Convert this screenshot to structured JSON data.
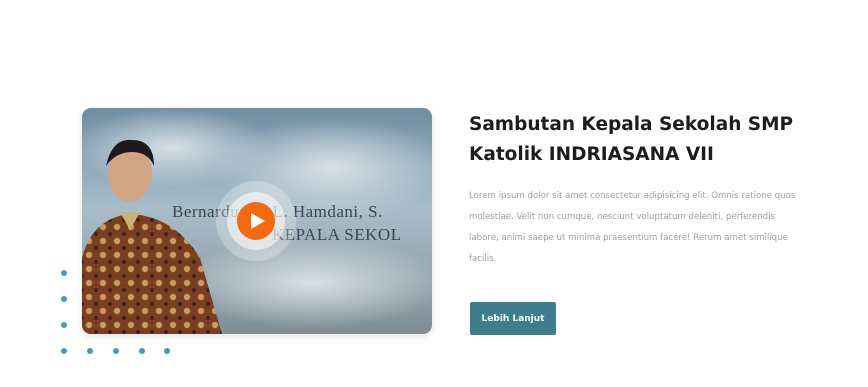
{
  "video": {
    "caption_name": "Bernardus B. L. Hamdani, S.",
    "caption_role": "KEPALA SEKOL"
  },
  "intro": {
    "title": "Sambutan Kepala Sekolah SMP Katolik INDRIASANA VII",
    "body": "Lorem ipsum dolor sit amet consectetur adipisicing elit. Omnis ratione quos molestiae. Velit non cumque, nesciunt voluptatum deleniti, perferendis labore, animi saepe ut minima praesentium facere! Rerum amet similique facilis.",
    "button_label": "Lebih Lanjut"
  },
  "colors": {
    "accent": "#f36a10",
    "button": "#3f7d8c",
    "dots": "#3f9ac7"
  },
  "icons": {
    "play": "play-icon"
  }
}
